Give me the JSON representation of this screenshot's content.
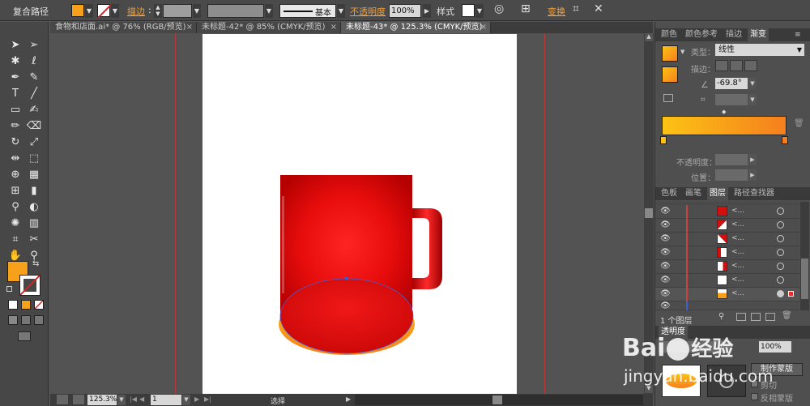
{
  "control_bar": {
    "object_type": "复合路径",
    "stroke_label": "描边",
    "stroke_style": "基本",
    "opacity_label": "不透明度",
    "opacity_value": "100%",
    "style_label": "样式",
    "transform_label": "变换",
    "fill_color": "#f7a11a",
    "stroke_color": "none"
  },
  "tabs": [
    {
      "label": "食物和店面.ai* @ 76% (RGB/预览)",
      "close": "×"
    },
    {
      "label": "未标题-42* @ 85% (CMYK/预览)",
      "close": "×"
    },
    {
      "label": "未标题-43* @ 125.3% (CMYK/预览)",
      "close": "×",
      "active": true
    }
  ],
  "status_bar": {
    "zoom": "125.3%",
    "artboard_number": "1",
    "tool_name": "选择"
  },
  "gradient_panel": {
    "tabs": [
      "颜色",
      "颜色参考",
      "描边",
      "渐变"
    ],
    "type_label": "类型：",
    "type_value": "线性",
    "stroke_label": "描边：",
    "angle_value": "-69.8°",
    "opacity_label": "不透明度：",
    "position_label": "位置：",
    "gradient_start": "#fcc314",
    "gradient_end": "#f57f1e"
  },
  "layers_panel": {
    "tabs": [
      "色板",
      "画笔",
      "图层",
      "路径查找器"
    ],
    "row_name": "<...",
    "layer_count": "1 个图层"
  },
  "transparency_panel": {
    "title": "透明度",
    "opacity_value": "100%",
    "make_mask_button": "制作蒙版",
    "clip_label": "剪切",
    "invert_mask_label": "反相蒙版"
  },
  "watermark": {
    "brand": "Bai",
    "brand_suffix": "经验",
    "url": "jingyan.baidu.com"
  },
  "toolbox": {
    "fill_color": "#f7a11a"
  }
}
